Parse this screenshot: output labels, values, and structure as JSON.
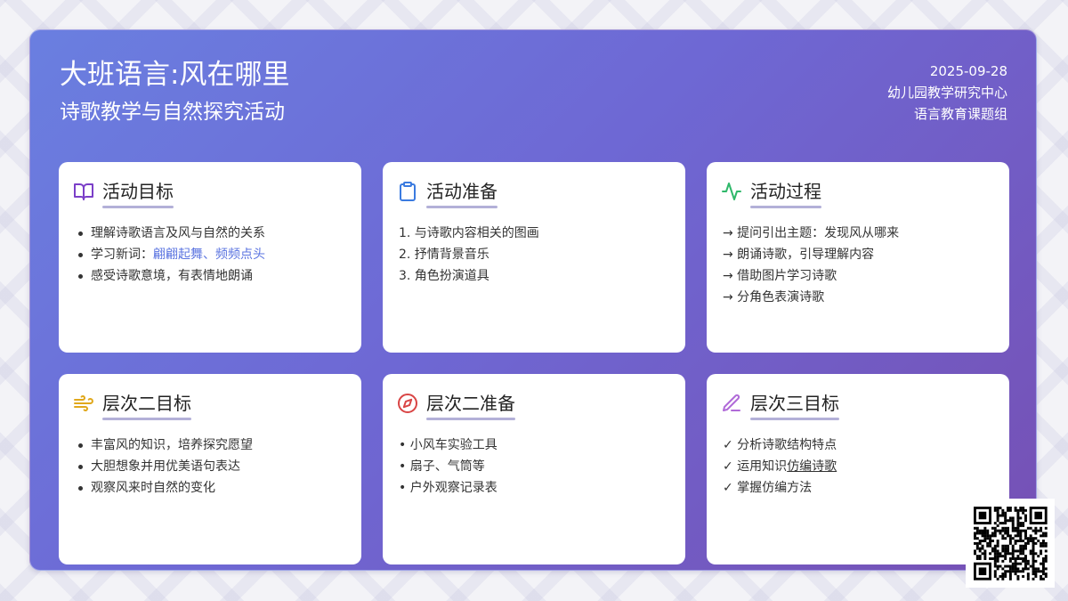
{
  "header": {
    "title": "大班语言:风在哪里",
    "subtitle": "诗歌教学与自然探究活动",
    "date": "2025-09-28",
    "org": "幼儿园教学研究中心",
    "group": "语言教育课题组"
  },
  "cards": [
    {
      "icon": "book-icon",
      "title": "活动目标",
      "items": [
        "理解诗歌语言及风与自然的关系",
        "学习新词：",
        "感受诗歌意境，有表情地朗诵"
      ],
      "item2_highlight": "翩翩起舞、频频点头"
    },
    {
      "icon": "clipboard-icon",
      "title": "活动准备",
      "items": [
        "1. 与诗歌内容相关的图画",
        "2. 抒情背景音乐",
        "3. 角色扮演道具"
      ]
    },
    {
      "icon": "activity-icon",
      "title": "活动过程",
      "items": [
        "→ 提问引出主题：发现风从哪来",
        "→ 朗诵诗歌，引导理解内容",
        "→ 借助图片学习诗歌",
        "→ 分角色表演诗歌"
      ]
    },
    {
      "icon": "wind-icon",
      "title": "层次二目标",
      "items": [
        "丰富风的知识，培养探究愿望",
        "大胆想象并用优美语句表达",
        "观察风来时自然的变化"
      ]
    },
    {
      "icon": "compass-icon",
      "title": "层次二准备",
      "items": [
        "• 小风车实验工具",
        "• 扇子、气筒等",
        "• 户外观察记录表"
      ]
    },
    {
      "icon": "pen-icon",
      "title": "层次三目标",
      "items": [
        "✓ 分析诗歌结构特点",
        "✓ 运用知识",
        "✓ 掌握仿编方法"
      ],
      "item2_underline": "仿编诗歌"
    }
  ],
  "colors": {
    "book": "#7b3fc8",
    "clipboard": "#3b7be0",
    "activity": "#2fb86a",
    "wind": "#e0a81c",
    "compass": "#d94545",
    "pen": "#b06ad8",
    "highlight": "#5b74e0"
  },
  "qr": {
    "icon": "qr-code-icon"
  }
}
